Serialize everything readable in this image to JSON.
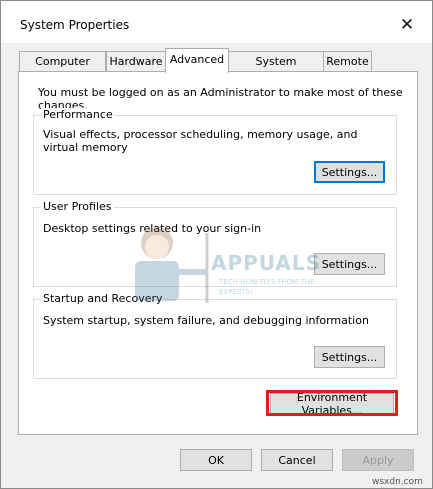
{
  "window": {
    "title": "System Properties"
  },
  "tabs": [
    {
      "label": "Computer Name"
    },
    {
      "label": "Hardware"
    },
    {
      "label": "Advanced",
      "active": true
    },
    {
      "label": "System Protection"
    },
    {
      "label": "Remote"
    }
  ],
  "advanced": {
    "admin_note": "You must be logged on as an Administrator to make most of these changes.",
    "performance": {
      "legend": "Performance",
      "description": "Visual effects, processor scheduling, memory usage, and virtual memory",
      "button": "Settings..."
    },
    "user_profiles": {
      "legend": "User Profiles",
      "description": "Desktop settings related to your sign-in",
      "button": "Settings..."
    },
    "startup_recovery": {
      "legend": "Startup and Recovery",
      "description": "System startup, system failure, and debugging information",
      "button": "Settings..."
    },
    "env_button": "Environment Variables..."
  },
  "footer": {
    "ok": "OK",
    "cancel": "Cancel",
    "apply": "Apply"
  },
  "watermark": {
    "brand": "APPUALS",
    "tagline": "TECH HOW-TO'S FROM THE EXPERTS!"
  },
  "source_text": "wsxdn.com",
  "colors": {
    "accent": "#0078d7",
    "highlight": "#e41c1c"
  }
}
